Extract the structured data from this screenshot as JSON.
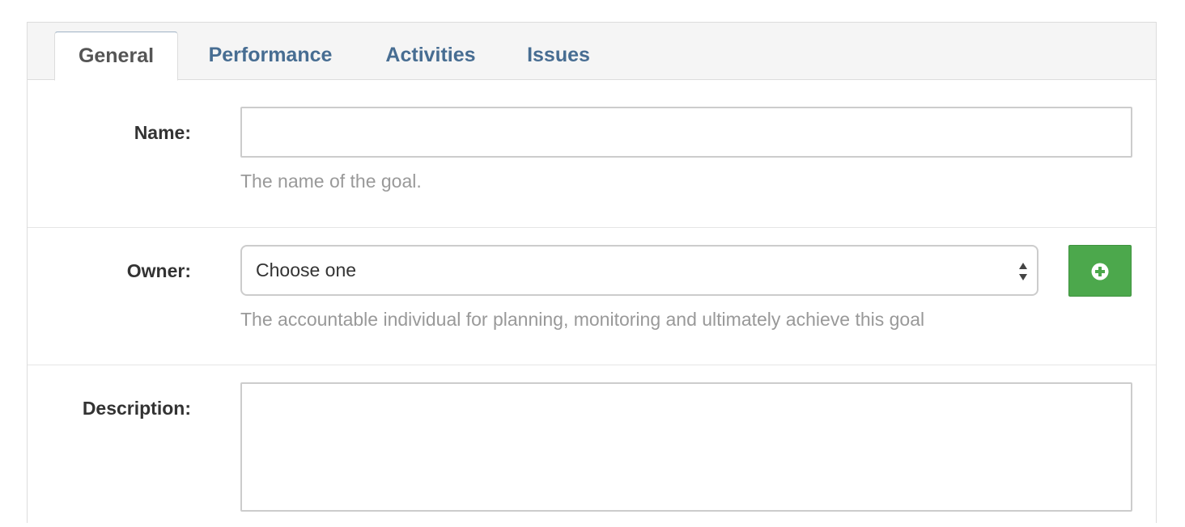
{
  "tabs": [
    {
      "label": "General",
      "active": true
    },
    {
      "label": "Performance",
      "active": false
    },
    {
      "label": "Activities",
      "active": false
    },
    {
      "label": "Issues",
      "active": false
    }
  ],
  "form": {
    "name": {
      "label": "Name:",
      "value": "",
      "help": "The name of the goal."
    },
    "owner": {
      "label": "Owner:",
      "selected": "Choose one",
      "help": "The accountable individual for planning, monitoring and ultimately achieve this goal",
      "add_icon": "plus-circle-icon"
    },
    "description": {
      "label": "Description:",
      "value": ""
    }
  },
  "colors": {
    "tab_link": "#476d92",
    "tab_active_text": "#555555",
    "add_button": "#4ca84c",
    "help_text": "#999999"
  }
}
